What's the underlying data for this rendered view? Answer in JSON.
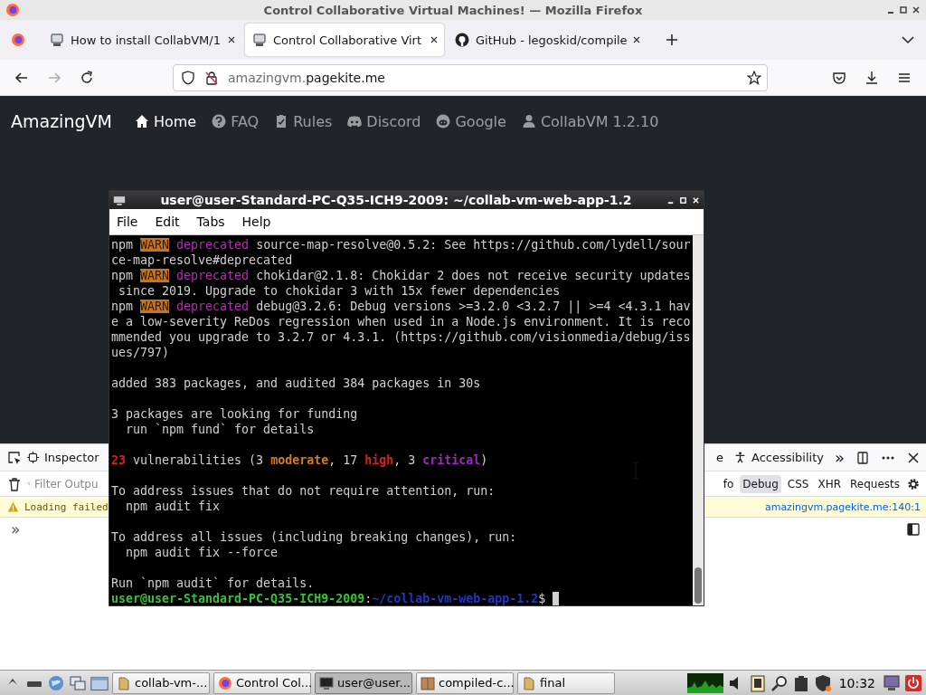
{
  "window": {
    "title": "Control Collaborative Virtual Machines! — Mozilla Firefox"
  },
  "tabs": [
    {
      "title": "How to install CollabVM/1",
      "kind": "vm",
      "selected": false
    },
    {
      "title": "Control Collaborative Virt",
      "kind": "vm",
      "selected": true
    },
    {
      "title": "GitHub - legoskid/compile",
      "kind": "github",
      "selected": false
    }
  ],
  "toolbar": {
    "forward_disabled": true,
    "address_prefix": "amazingvm.",
    "address_host": "pagekite.me"
  },
  "site": {
    "brand": "AmazingVM",
    "nav": [
      {
        "label": "Home",
        "kind": "home",
        "selected": true
      },
      {
        "label": "FAQ",
        "kind": "faq",
        "selected": false
      },
      {
        "label": "Rules",
        "kind": "rules",
        "selected": false
      },
      {
        "label": "Discord",
        "kind": "discord",
        "selected": false
      },
      {
        "label": "Google",
        "kind": "google",
        "selected": false
      },
      {
        "label": "CollabVM 1.2.10",
        "kind": "user",
        "selected": false
      }
    ]
  },
  "terminal": {
    "title": "user@user-Standard-PC-Q35-ICH9-2009: ~/collab-vm-web-app-1.2",
    "menu": [
      "File",
      "Edit",
      "Tabs",
      "Help"
    ],
    "blocks": [
      {
        "lines": [
          {
            "segments": [
              {
                "text": "npm ",
                "kind": "plain"
              },
              {
                "text": "WARN",
                "kind": "warn"
              },
              {
                "text": " deprecated",
                "kind": "deprecated"
              },
              {
                "text": " source-map-resolve@0.5.2: See https://github.com/lydell/sour",
                "kind": "plain"
              }
            ]
          },
          {
            "segments": [
              {
                "text": "ce-map-resolve#deprecated",
                "kind": "plain"
              }
            ]
          },
          {
            "segments": [
              {
                "text": "npm ",
                "kind": "plain"
              },
              {
                "text": "WARN",
                "kind": "warn"
              },
              {
                "text": " deprecated",
                "kind": "deprecated"
              },
              {
                "text": " chokidar@2.1.8: Chokidar 2 does not receive security updates",
                "kind": "plain"
              }
            ]
          },
          {
            "segments": [
              {
                "text": " since 2019. Upgrade to chokidar 3 with 15x fewer dependencies",
                "kind": "plain"
              }
            ]
          },
          {
            "segments": [
              {
                "text": "npm ",
                "kind": "plain"
              },
              {
                "text": "WARN",
                "kind": "warn"
              },
              {
                "text": " deprecated",
                "kind": "deprecated"
              },
              {
                "text": " debug@3.2.6: Debug versions >=3.2.0 <3.2.7 || >=4 <4.3.1 hav",
                "kind": "plain"
              }
            ]
          },
          {
            "segments": [
              {
                "text": "e a low-severity ReDos regression when used in a Node.js environment. It is reco",
                "kind": "plain"
              }
            ]
          },
          {
            "segments": [
              {
                "text": "mmended you upgrade to 3.2.7 or 4.3.1. (https://github.com/visionmedia/debug/iss",
                "kind": "plain"
              }
            ]
          },
          {
            "segments": [
              {
                "text": "ues/797)",
                "kind": "plain"
              }
            ]
          }
        ]
      },
      {
        "lines": [
          {
            "segments": [
              {
                "text": "added 383 packages, and audited 384 packages in 30s",
                "kind": "plain"
              }
            ]
          }
        ]
      },
      {
        "lines": [
          {
            "segments": [
              {
                "text": "3 packages are looking for funding",
                "kind": "plain"
              }
            ]
          },
          {
            "segments": [
              {
                "text": "  run `npm fund` for details",
                "kind": "plain"
              }
            ]
          }
        ]
      },
      {
        "lines": [
          {
            "segments": [
              {
                "text": "23",
                "kind": "count"
              },
              {
                "text": " vulnerabilities (3 ",
                "kind": "plain"
              },
              {
                "text": "moderate",
                "kind": "moderate"
              },
              {
                "text": ", 17 ",
                "kind": "plain"
              },
              {
                "text": "high",
                "kind": "high"
              },
              {
                "text": ", 3 ",
                "kind": "plain"
              },
              {
                "text": "critical",
                "kind": "critical"
              },
              {
                "text": ")",
                "kind": "plain"
              }
            ]
          }
        ]
      },
      {
        "lines": [
          {
            "segments": [
              {
                "text": "To address issues that do not require attention, run:",
                "kind": "plain"
              }
            ]
          },
          {
            "segments": [
              {
                "text": "  npm audit fix",
                "kind": "plain"
              }
            ]
          }
        ]
      },
      {
        "lines": [
          {
            "segments": [
              {
                "text": "To address all issues (including breaking changes), run:",
                "kind": "plain"
              }
            ]
          },
          {
            "segments": [
              {
                "text": "  npm audit fix --force",
                "kind": "plain"
              }
            ]
          }
        ]
      },
      {
        "lines": [
          {
            "segments": [
              {
                "text": "Run `npm audit` for details.",
                "kind": "plain"
              }
            ]
          },
          {
            "segments": [
              {
                "text": "user@user-Standard-PC-Q35-ICH9-2009",
                "kind": "user"
              },
              {
                "text": ":",
                "kind": "plain"
              },
              {
                "text": "~/collab-vm-web-app-1.2",
                "kind": "path"
              },
              {
                "text": "$ ",
                "kind": "plain"
              }
            ]
          }
        ]
      }
    ]
  },
  "devtools": {
    "tab": "Inspector",
    "cut_tab": "e",
    "accessibility": "Accessibility",
    "more": "»",
    "filter_placeholder": "Filter Outpu",
    "filters": [
      {
        "label": "fo",
        "selected": false
      },
      {
        "label": "Debug",
        "selected": true
      },
      {
        "label": "CSS",
        "selected": false
      },
      {
        "label": "XHR",
        "selected": false
      },
      {
        "label": "Requests",
        "selected": false
      }
    ],
    "warning": "Loading failed",
    "warning_link": "amazingvm.pagekite.me:140:1",
    "prompt": "»"
  },
  "taskbar": {
    "tasks": [
      {
        "label": "collab-vm-...",
        "kind": "folder",
        "selected": false
      },
      {
        "label": "Control Col...",
        "kind": "firefox",
        "selected": false
      },
      {
        "label": "user@user...",
        "kind": "terminal",
        "selected": true
      },
      {
        "label": "compiled-c...",
        "kind": "package",
        "selected": false
      },
      {
        "label": "final",
        "kind": "folder",
        "selected": false
      }
    ],
    "clock": "10:32"
  }
}
